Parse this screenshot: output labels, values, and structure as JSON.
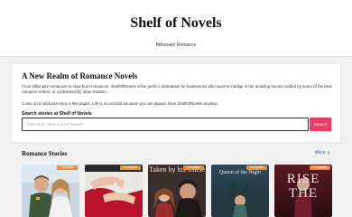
{
  "site": {
    "title": "Shelf of Novels"
  },
  "nav": {
    "active": "Billionaire Romance"
  },
  "intro": {
    "heading": "A New Realm of Romance Novels",
    "paragraph1": "From billionaire romances to slow-burn romances, ShelfOfNovels is the perfect destination for bookworms who want to indulge in the amazing stories crafted by some of the best romance writers, or contributed by other readers.",
    "paragraph2": "Come on in and just enjoy a few pages. Life is so not bad because you can always have ShelfOfNovels anytime."
  },
  "search": {
    "label": "Search stories at Shelf of Novels",
    "placeholder": "Enter story name and hit \"Search\"",
    "button": "Search"
  },
  "romance": {
    "title": "Romance Stories",
    "more": "More",
    "books": [
      {
        "badge": "Complete",
        "cover_title": ""
      },
      {
        "badge": "Complete",
        "cover_title": ""
      },
      {
        "badge": "Complete",
        "cover_title": "Taken by his Uncle"
      },
      {
        "badge": "Complete",
        "cover_title": "Queen of the Night"
      },
      {
        "badge": "Complete",
        "cover_title": "RISE THE"
      }
    ]
  },
  "colors": {
    "accent": "#ee3b63",
    "link": "#2e63c7",
    "badge": "#f08c2a"
  }
}
